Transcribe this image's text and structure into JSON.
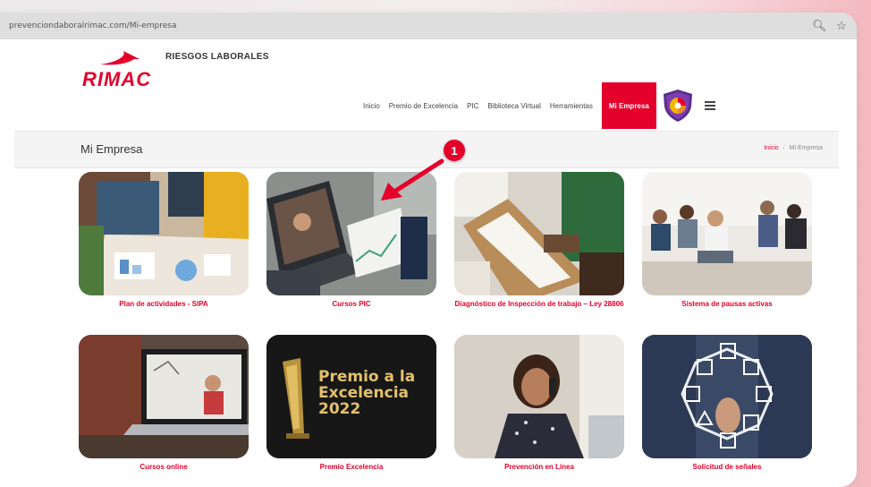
{
  "browser": {
    "url": "prevenciondaboralrimac.com/Mi-empresa",
    "icons": [
      "search-icon",
      "star-icon"
    ]
  },
  "brand": {
    "logo_text": "RIMAC",
    "subtitle": "RIESGOS LABORALES",
    "color": "#e4002b"
  },
  "nav": {
    "items": [
      "Inicio",
      "Premio de Excelencia",
      "PIC",
      "Biblioteca Virtual",
      "Herramientas"
    ],
    "active": "Mi Empresa"
  },
  "page": {
    "title": "Mi Empresa",
    "breadcrumb": [
      "Inicio",
      "Mi Empresa"
    ]
  },
  "annotation": {
    "marker": "1"
  },
  "cards": [
    {
      "label": "Plan de actividades - SIPA"
    },
    {
      "label": "Cursos PIC"
    },
    {
      "label": "Diagnóstico de Inspección de trabajo – Ley 28806"
    },
    {
      "label": "Sistema de pausas activas"
    },
    {
      "label": "Cursos online"
    },
    {
      "label": "Premio Excelencia",
      "image_text": [
        "Premio a la",
        "Excelencia",
        "2022"
      ]
    },
    {
      "label": "Prevención en Línea"
    },
    {
      "label": "Solicitud de señales"
    }
  ]
}
